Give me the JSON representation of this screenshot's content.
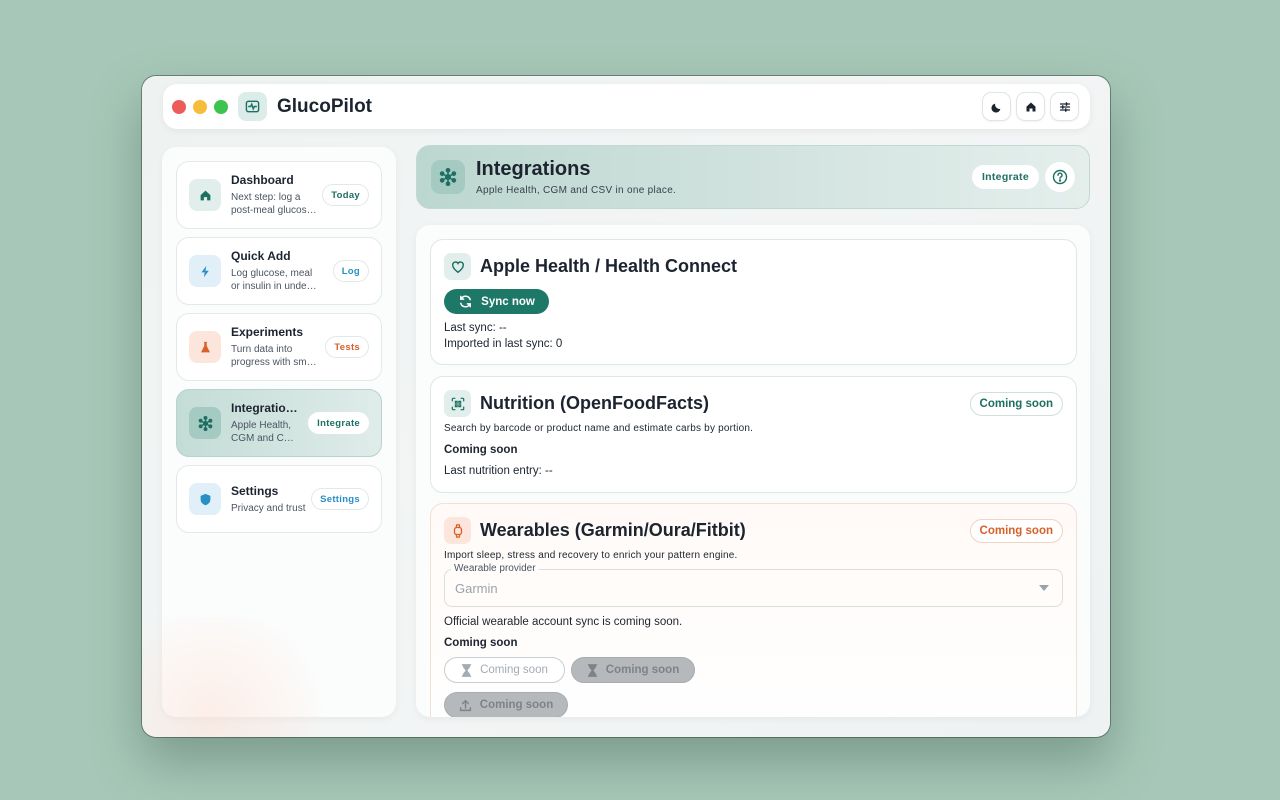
{
  "app": {
    "title": "GlucoPilot"
  },
  "titlebar": {
    "icons": [
      "moon-icon",
      "home-icon",
      "sliders-icon"
    ]
  },
  "sidebar": {
    "items": [
      {
        "title": "Dashboard",
        "desc": "Next step: log a post-meal glucose check",
        "badge": "Today",
        "badge_color": "#1d6f62",
        "icon": "home-icon"
      },
      {
        "title": "Quick Add",
        "desc": "Log glucose, meal or insulin in under a minute",
        "badge": "Log",
        "badge_color": "#2a8fc4",
        "icon": "bolt-icon"
      },
      {
        "title": "Experiments",
        "desc": "Turn data into progress with small tests",
        "badge": "Tests",
        "badge_color": "#d9602b",
        "icon": "flask-icon"
      },
      {
        "title": "Integrations",
        "desc": "Apple Health, CGM and CSV in one place",
        "badge": "Integrate",
        "badge_color": "#1d6f62",
        "icon": "hub-icon"
      },
      {
        "title": "Settings",
        "desc": "Privacy and trust",
        "badge": "Settings",
        "badge_color": "#2a8fc4",
        "icon": "shield-icon"
      }
    ]
  },
  "header": {
    "title": "Integrations",
    "subtitle": "Apple Health, CGM and CSV in one place.",
    "action": "Integrate"
  },
  "cards": {
    "apple": {
      "title": "Apple Health / Health Connect",
      "sync_button": "Sync now",
      "last_sync": "Last sync: --",
      "imported": "Imported in last sync: 0"
    },
    "nutrition": {
      "title": "Nutrition (OpenFoodFacts)",
      "pill": "Coming soon",
      "desc": "Search by barcode or product name and estimate carbs by portion.",
      "status": "Coming soon",
      "last_entry": "Last nutrition entry: --"
    },
    "wearables": {
      "title": "Wearables (Garmin/Oura/Fitbit)",
      "pill": "Coming soon",
      "desc": "Import sleep, stress and recovery to enrich your pattern engine.",
      "select_label": "Wearable provider",
      "select_value": "Garmin",
      "note": "Official wearable account sync is coming soon.",
      "status": "Coming soon",
      "btn1": "Coming soon",
      "btn2": "Coming soon",
      "btn3": "Coming soon"
    }
  },
  "colors": {
    "accent": "#1d7868",
    "orange": "#d9602b",
    "blue": "#2a8fc4"
  }
}
